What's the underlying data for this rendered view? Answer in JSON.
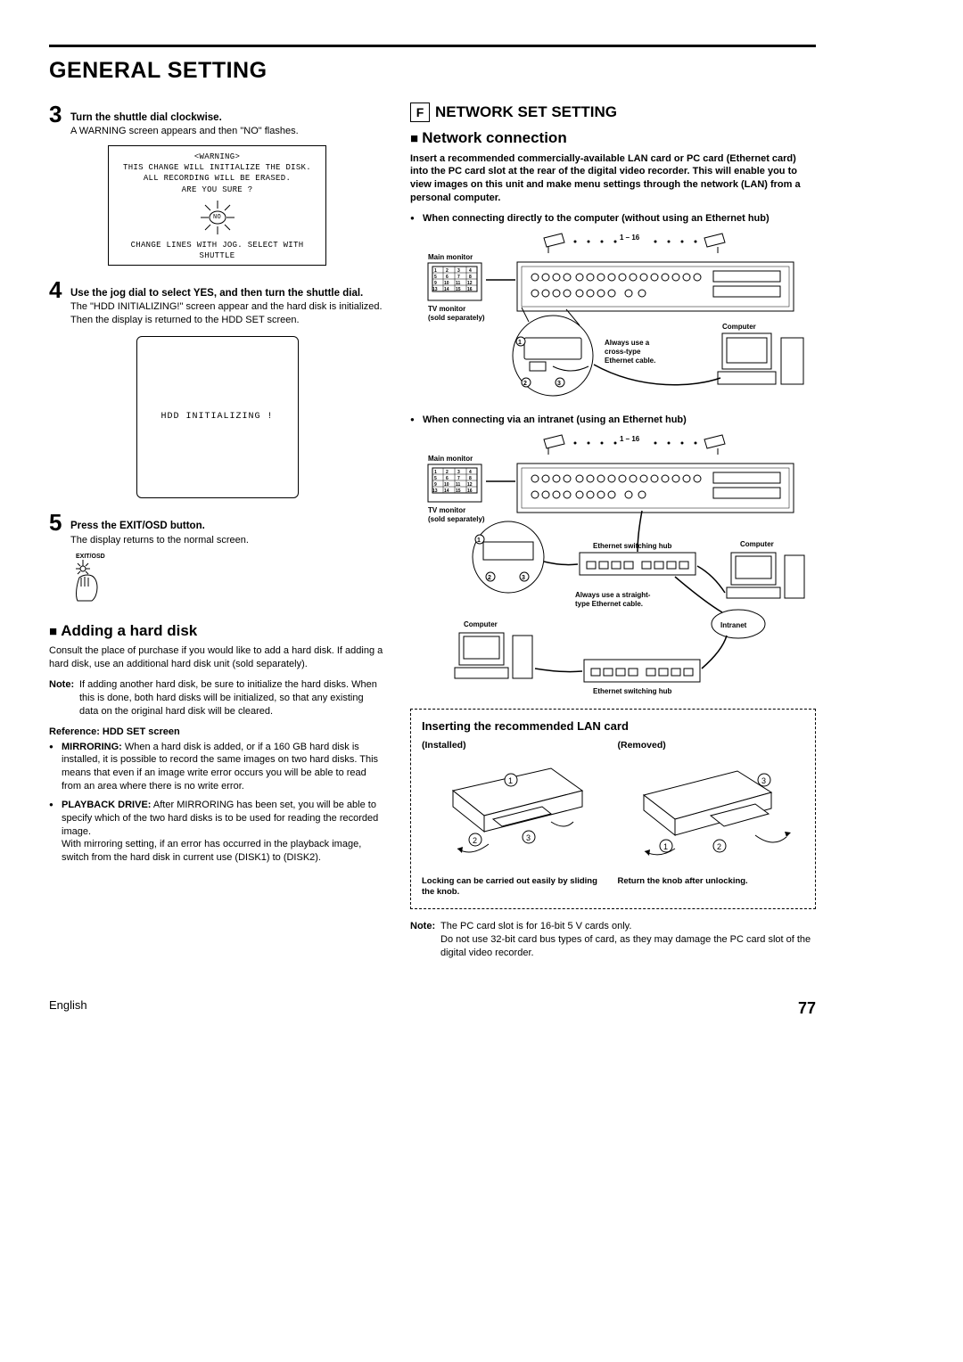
{
  "page_title": "GENERAL SETTING",
  "left": {
    "step3": {
      "num": "3",
      "head": "Turn the shuttle dial clockwise.",
      "text": "A WARNING screen appears and then \"NO\" flashes."
    },
    "warning": {
      "title": "<WARNING>",
      "l1": "THIS CHANGE WILL INITIALIZE THE DISK.",
      "l2": "ALL RECORDING WILL BE ERASED.",
      "l3": "ARE YOU SURE ?",
      "no": "NO",
      "foot": "CHANGE LINES WITH JOG. SELECT WITH SHUTTLE"
    },
    "step4": {
      "num": "4",
      "head": "Use the jog dial to select YES, and then turn the shuttle dial.",
      "text": "The \"HDD INITIALIZING!\" screen appear and the hard disk is initialized. Then the display is returned to the HDD SET screen."
    },
    "hdd_box": "HDD INITIALIZING !",
    "step5": {
      "num": "5",
      "head": "Press the EXIT/OSD button.",
      "text": "The display returns to the normal screen.",
      "icon_label": "EXIT/OSD"
    },
    "adding_title": "Adding a hard disk",
    "adding_p1": "Consult the place of purchase if you would like to add a hard disk. If adding a hard disk, use an additional hard disk unit (sold separately).",
    "note_label": "Note:",
    "adding_note": "If adding another hard disk, be sure to initialize the hard disks. When this is done, both hard disks will be initialized, so that any existing data on the original hard disk will be cleared.",
    "ref_title": "Reference: HDD SET screen",
    "mirror_label": "MIRRORING:",
    "mirror_text": "When a hard disk is added, or if a 160 GB hard disk is installed, it is possible to record the same images on two hard disks. This means that even if an image write error occurs you will be able to read from an area where there is no write error.",
    "play_label": "PLAYBACK DRIVE:",
    "play_text1": "After MIRRORING has been set, you will be able to specify which of the two hard disks is to be used for reading the recorded image.",
    "play_text2": "With mirroring setting, if an error has occurred in the playback image, switch from the hard disk in current use (DISK1) to (DISK2)."
  },
  "right": {
    "sec_letter": "F",
    "sec_title": "NETWORK SET SETTING",
    "net_title": "Network connection",
    "intro": "Insert a recommended commercially-available LAN card or PC card (Ethernet card) into the PC card slot at the rear of the digital video recorder. This will enable you to view images on this unit and make menu settings through the network (LAN) from a personal computer.",
    "bul1": "When connecting directly to the computer (without using an Ethernet hub)",
    "diag1": {
      "range": "1 – 16",
      "main_monitor": "Main monitor",
      "tv_monitor": "TV monitor",
      "sold": "(sold separately)",
      "computer": "Computer",
      "cable": "Always use a cross-type Ethernet cable."
    },
    "bul2": "When connecting via an intranet (using an Ethernet hub)",
    "diag2": {
      "range": "1 – 16",
      "main_monitor": "Main monitor",
      "tv_monitor": "TV monitor",
      "sold": "(sold separately)",
      "hub1": "Ethernet switching hub",
      "hub2": "Ethernet switching hub",
      "computer": "Computer",
      "computer2": "Computer",
      "intranet": "Intranet",
      "cable": "Always use a straight-type Ethernet cable."
    },
    "lan_title": "Inserting the recommended LAN card",
    "lan_installed": "(Installed)",
    "lan_removed": "(Removed)",
    "lan_cap1": "Locking can be carried out easily by sliding the knob.",
    "lan_cap2": "Return the knob after unlocking.",
    "note_label": "Note:",
    "final_note1": "The PC card slot is for 16-bit 5 V cards only.",
    "final_note2": "Do not use 32-bit card bus types of card, as they may damage the PC card slot of the digital video recorder."
  },
  "footer": {
    "lang": "English",
    "page": "77"
  }
}
